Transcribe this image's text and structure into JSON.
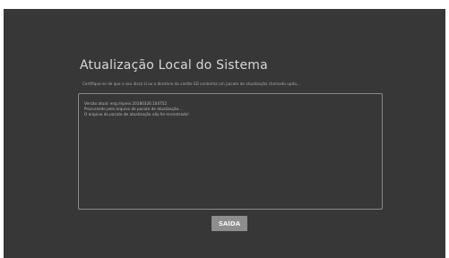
{
  "dialog": {
    "title": "Atualização Local do Sistema",
    "hint": "Certifique-se de que o seu disco U ou o diretório do cartão SD contenha um pacote de atualização chamado upda...",
    "log_lines": [
      "Versão atual: eng.mipeix.20180326.104752",
      "Procurando pelo arquivo de pacote de atualização...",
      "O arquivo do pacote de atualização não foi encontrado!"
    ],
    "exit_label": "SAÍDA"
  }
}
